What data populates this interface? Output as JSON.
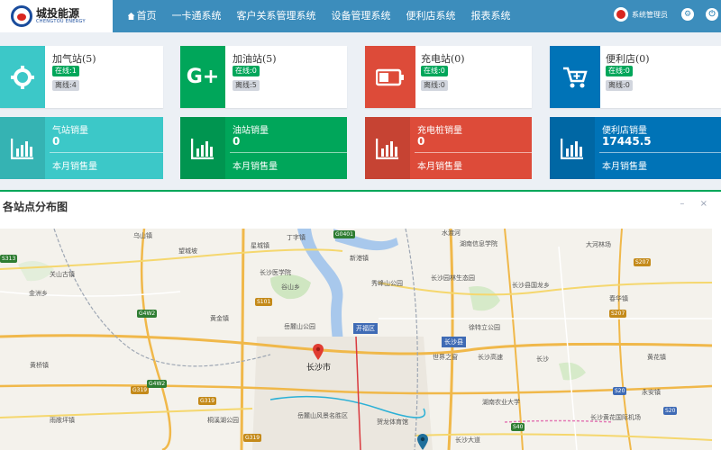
{
  "header": {
    "logo_cn": "城投能源",
    "logo_en": "CHENGTOU ENERGY",
    "nav": [
      "首页",
      "一卡通系统",
      "客户关系管理系统",
      "设备管理系统",
      "便利店系统",
      "报表系统"
    ],
    "user_label": "系统管理员",
    "settings_icon": "gear-icon",
    "logout_icon": "power-icon"
  },
  "colors": {
    "header_bg": "#3c8dbc",
    "cyan": "#00c0ef",
    "green": "#00a65a",
    "red": "#dd4b39",
    "blue": "#0073b7",
    "online_badge": "#00a65a",
    "offline_badge": "#d2d6de"
  },
  "station_cards": [
    {
      "title": "加气站(5)",
      "online": "在线:1",
      "offline": "离线:4",
      "icon": "crosshair-icon",
      "color": "#3cc8c8"
    },
    {
      "title": "加油站(5)",
      "online": "在线:0",
      "offline": "离线:5",
      "icon": "google-plus-icon",
      "color": "#00a65a"
    },
    {
      "title": "充电站(0)",
      "online": "在线:0",
      "offline": "离线:0",
      "icon": "battery-icon",
      "color": "#dd4b39"
    },
    {
      "title": "便利店(0)",
      "online": "在线:0",
      "offline": "离线:0",
      "icon": "cart-plus-icon",
      "color": "#0073b7"
    }
  ],
  "sales_cards": [
    {
      "label": "气站销量",
      "value": "0",
      "footer": "本月销售量",
      "icon": "bar-chart-icon",
      "color": "#3cc8c8"
    },
    {
      "label": "油站销量",
      "value": "0",
      "footer": "本月销售量",
      "icon": "bar-chart-icon",
      "color": "#00a65a"
    },
    {
      "label": "充电桩销量",
      "value": "0",
      "footer": "本月销售量",
      "icon": "bar-chart-icon",
      "color": "#dd4b39"
    },
    {
      "label": "便利店销量",
      "value": "17445.5",
      "footer": "本月销售量",
      "icon": "bar-chart-icon",
      "color": "#0073b7"
    }
  ],
  "map_panel": {
    "title": "各站点分布图",
    "collapse": "–",
    "close": "×",
    "city": "长沙市",
    "district_labels": [
      "开福区",
      "长沙县"
    ],
    "labels": [
      "乌山镇",
      "望城坡",
      "星城镇",
      "丁字镇",
      "新港镇",
      "水渡河",
      "湖南信息学院",
      "大河林场",
      "关山古镇",
      "金洲乡",
      "长沙医学院",
      "谷山乡",
      "秀峰山公园",
      "长沙园林生态园",
      "长沙县国龙乡",
      "春华镇",
      "黄金镇",
      "岳麓山公园",
      "徐特立公园",
      "世界之窗",
      "黄桥镇",
      "长沙",
      "长沙高速",
      "黄花镇",
      "雨敞坪镇",
      "桐溪湖公园",
      "岳麓山风景名胜区",
      "贺龙体育馆",
      "湖南农业大学",
      "长沙黄花国际机场",
      "永安镇",
      "长沙大道"
    ],
    "shields": [
      "S313",
      "G0401",
      "S207",
      "G4W2",
      "S101",
      "G319",
      "G319",
      "G4W2",
      "G319",
      "S20",
      "S40",
      "S207",
      "S20"
    ]
  }
}
